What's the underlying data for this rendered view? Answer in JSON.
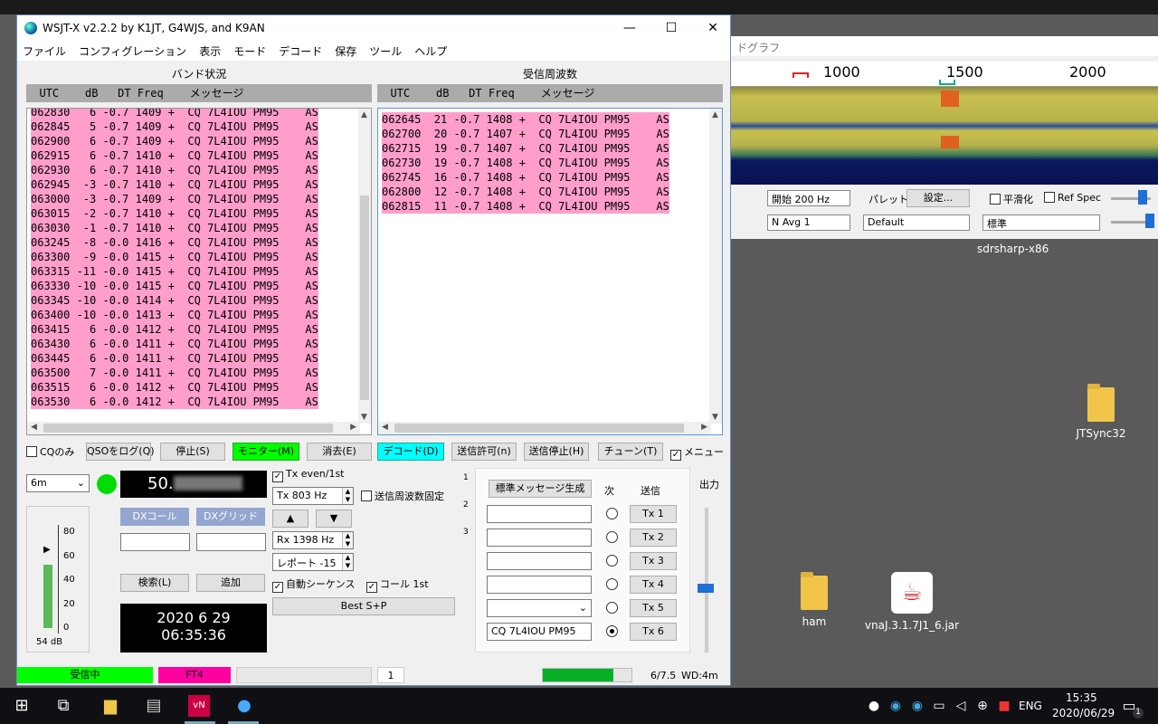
{
  "window": {
    "title": "WSJT-X   v2.2.2   by K1JT, G4WJS, and K9AN"
  },
  "menu": [
    "ファイル",
    "コンフィグレーション",
    "表示",
    "モード",
    "デコード",
    "保存",
    "ツール",
    "ヘルプ"
  ],
  "band_activity": {
    "title": "バンド状況",
    "header": "  UTC    dB   DT Freq    メッセージ",
    "rows": [
      "062830   6 -0.7 1409 +  CQ 7L4IOU PM95    AS",
      "062845   5 -0.7 1409 +  CQ 7L4IOU PM95    AS",
      "062900   6 -0.7 1409 +  CQ 7L4IOU PM95    AS",
      "062915   6 -0.7 1410 +  CQ 7L4IOU PM95    AS",
      "062930   6 -0.7 1410 +  CQ 7L4IOU PM95    AS",
      "062945  -3 -0.7 1410 +  CQ 7L4IOU PM95    AS",
      "063000  -3 -0.7 1409 +  CQ 7L4IOU PM95    AS",
      "063015  -2 -0.7 1410 +  CQ 7L4IOU PM95    AS",
      "063030  -1 -0.7 1410 +  CQ 7L4IOU PM95    AS",
      "063245  -8 -0.0 1416 +  CQ 7L4IOU PM95    AS",
      "063300  -9 -0.0 1415 +  CQ 7L4IOU PM95    AS",
      "063315 -11 -0.0 1415 +  CQ 7L4IOU PM95    AS",
      "063330 -10 -0.0 1415 +  CQ 7L4IOU PM95    AS",
      "063345 -10 -0.0 1414 +  CQ 7L4IOU PM95    AS",
      "063400 -10 -0.0 1413 +  CQ 7L4IOU PM95    AS",
      "063415   6 -0.0 1412 +  CQ 7L4IOU PM95    AS",
      "063430   6 -0.0 1411 +  CQ 7L4IOU PM95    AS",
      "063445   6 -0.0 1411 +  CQ 7L4IOU PM95    AS",
      "063500   7 -0.0 1411 +  CQ 7L4IOU PM95    AS",
      "063515   6 -0.0 1412 +  CQ 7L4IOU PM95    AS",
      "063530   6 -0.0 1412 +  CQ 7L4IOU PM95    AS"
    ]
  },
  "rx_frequency": {
    "title": "受信周波数",
    "header": "  UTC    dB   DT Freq    メッセージ",
    "rows": [
      "062645  21 -0.7 1408 +  CQ 7L4IOU PM95    AS",
      "062700  20 -0.7 1407 +  CQ 7L4IOU PM95    AS",
      "062715  19 -0.7 1407 +  CQ 7L4IOU PM95    AS",
      "062730  19 -0.7 1408 +  CQ 7L4IOU PM95    AS",
      "062745  16 -0.7 1408 +  CQ 7L4IOU PM95    AS",
      "062800  12 -0.7 1408 +  CQ 7L4IOU PM95    AS",
      "062815  11 -0.7 1408 +  CQ 7L4IOU PM95    AS"
    ]
  },
  "buttons": {
    "cq_only": "CQのみ",
    "log_qso": "QSOをログ(Q)",
    "stop": "停止(S)",
    "monitor": "モニター(M)",
    "erase": "消去(E)",
    "decode": "デコード(D)",
    "enable_tx": "送信許可(n)",
    "halt_tx": "送信停止(H)",
    "tune": "チューン(T)",
    "menus": "メニュー",
    "dx_call": "DXコール",
    "dx_grid": "DXグリッド",
    "lookup": "検索(L)",
    "add": "追加",
    "best_sp": "Best S+P",
    "gen_msgs": "標準メッセージ生成",
    "next": "次",
    "now": "送信",
    "tx": [
      "Tx 1",
      "Tx 2",
      "Tx 3",
      "Tx 4",
      "Tx 5",
      "Tx 6"
    ]
  },
  "controls": {
    "band": "6m",
    "freq": "50.",
    "tx_even": "Tx even/1st",
    "tx_hz": "Tx  803  Hz",
    "hold_tx": "送信周波数固定",
    "rx_hz": "Rx  1398  Hz",
    "report": "レポート -15",
    "auto_seq": "自動シーケンス",
    "call_1st": "コール 1st",
    "level": "54 dB",
    "meter_ticks": [
      "80",
      "60",
      "40",
      "20",
      "0"
    ],
    "date": "2020 6 29",
    "time": "06:35:36",
    "tx6_msg": "CQ 7L4IOU PM95",
    "power_label": "出力",
    "tabs": [
      "1",
      "2",
      "3"
    ]
  },
  "status": {
    "receiving": "受信中",
    "mode": "FT4",
    "count": "1",
    "progress_text": "6/7.5",
    "wd": "WD:4m",
    "progress": 0.8
  },
  "sdr": {
    "title": "ドグラフ",
    "ticks": [
      "1000",
      "1500",
      "2000"
    ],
    "start": "開始 200 Hz",
    "navg": "N Avg 1",
    "palette": "パレット",
    "settings": "設定...",
    "default": "Default",
    "flatten": "平滑化",
    "ref_spec": "Ref Spec",
    "standard": "標準",
    "name": "sdrsharp-x86"
  },
  "desktop": {
    "icons": [
      "JTSync32",
      "ham",
      "vnaJ.3.1.7J1_6.jar"
    ]
  },
  "taskbar": {
    "lang": "ENG",
    "time": "15:35",
    "date": "2020/06/29",
    "notif": "1"
  }
}
